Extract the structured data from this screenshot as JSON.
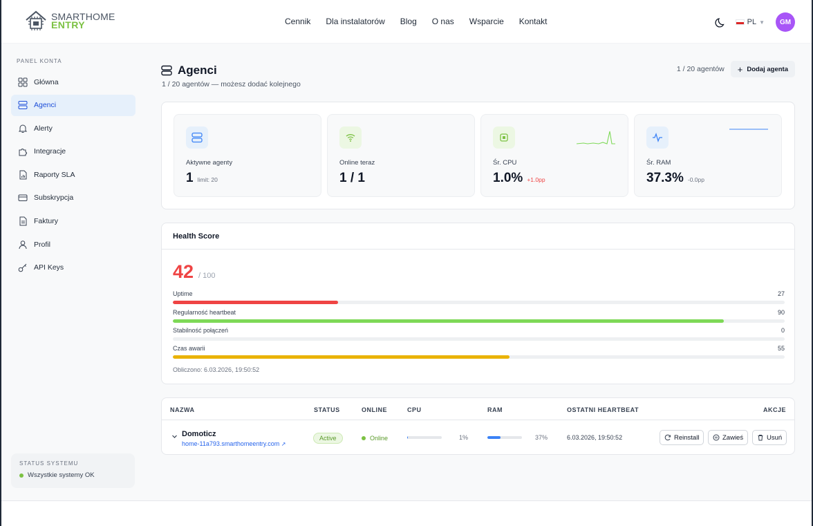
{
  "brand": {
    "line1": "SMARTHOME",
    "line2": "ENTRY"
  },
  "nav": [
    "Cennik",
    "Dla instalatorów",
    "Blog",
    "O nas",
    "Wsparcie",
    "Kontakt"
  ],
  "lang": "PL",
  "avatar": "GM",
  "sidebar": {
    "heading": "PANEL KONTA",
    "items": [
      {
        "label": "Główna",
        "icon": "grid-icon"
      },
      {
        "label": "Agenci",
        "icon": "server-icon",
        "active": true
      },
      {
        "label": "Alerty",
        "icon": "bell-icon"
      },
      {
        "label": "Integracje",
        "icon": "puzzle-icon"
      },
      {
        "label": "Raporty SLA",
        "icon": "report-icon"
      },
      {
        "label": "Subskrypcja",
        "icon": "card-icon"
      },
      {
        "label": "Faktury",
        "icon": "invoice-icon"
      },
      {
        "label": "Profil",
        "icon": "user-icon"
      },
      {
        "label": "API Keys",
        "icon": "key-icon"
      }
    ],
    "status_title": "STATUS SYSTEMU",
    "status_text": "Wszystkie systemy OK"
  },
  "page": {
    "title": "Agenci",
    "subtitle": "1 / 20 agentów — możesz dodać kolejnego",
    "count": "1 / 20 agentów",
    "add_button": "Dodaj agenta"
  },
  "stats": [
    {
      "label": "Aktywne agenty",
      "value": "1",
      "note": "limit: 20",
      "icon": "server-icon",
      "note_color": "#6b7280"
    },
    {
      "label": "Online teraz",
      "value": "1 / 1",
      "note": "",
      "icon": "wifi-icon"
    },
    {
      "label": "Śr. CPU",
      "value": "1.0%",
      "note": "+1.0pp",
      "icon": "cpu-icon",
      "note_color": "#ef4444"
    },
    {
      "label": "Śr. RAM",
      "value": "37.3%",
      "note": "-0.0pp",
      "icon": "activity-icon",
      "note_color": "#6b7280"
    }
  ],
  "health": {
    "title": "Health Score",
    "score": "42",
    "max": "/ 100",
    "metrics": [
      {
        "label": "Uptime",
        "value": "27",
        "fraction": 0.27,
        "color": "#ef4444"
      },
      {
        "label": "Regularność heartbeat",
        "value": "90",
        "fraction": 0.9,
        "color": "#7ed957"
      },
      {
        "label": "Stabilność połączeń",
        "value": "0",
        "fraction": 0,
        "color": "#9ca3af"
      },
      {
        "label": "Czas awarii",
        "value": "55",
        "fraction": 0.55,
        "color": "#eab308"
      }
    ],
    "computed": "Obliczono: 6.03.2026, 19:50:52"
  },
  "table": {
    "headers": {
      "name": "NAZWA",
      "status": "STATUS",
      "online": "ONLINE",
      "cpu": "CPU",
      "ram": "RAM",
      "heartbeat": "OSTATNI HEARTBEAT",
      "actions": "AKCJE"
    },
    "rows": [
      {
        "name": "Domoticz",
        "host": "home-11a793.smarthomeentry.com",
        "status": "Active",
        "online": "Online",
        "cpu": "1%",
        "cpu_fraction": 0.01,
        "ram": "37%",
        "ram_fraction": 0.37,
        "heartbeat": "6.03.2026, 19:50:52",
        "actions": [
          "Reinstall",
          "Zawieś",
          "Usuń"
        ]
      }
    ]
  }
}
